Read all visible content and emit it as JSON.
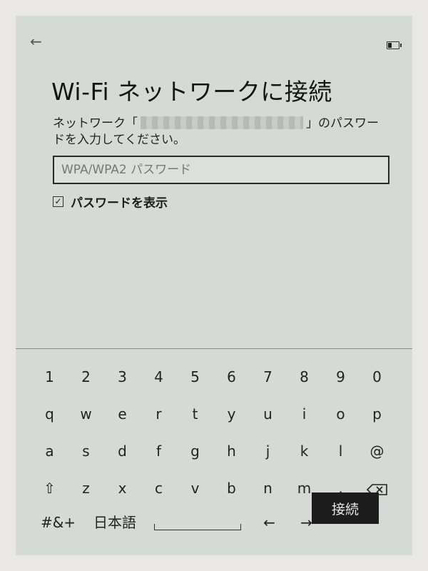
{
  "status": {
    "battery_level": 0.4
  },
  "header": {
    "back_icon": "arrow-left-icon"
  },
  "title": "Wi-Fi ネットワークに接続",
  "description": {
    "prefix": "ネットワーク「",
    "suffix": "」のパスワードを入力してください。"
  },
  "password": {
    "placeholder": "WPA/WPA2 パスワード",
    "value": ""
  },
  "show_password": {
    "label": "パスワードを表示",
    "checked": true
  },
  "keyboard": {
    "row1": [
      "1",
      "2",
      "3",
      "4",
      "5",
      "6",
      "7",
      "8",
      "9",
      "0"
    ],
    "row2": [
      "q",
      "w",
      "e",
      "r",
      "t",
      "y",
      "u",
      "i",
      "o",
      "p"
    ],
    "row3": [
      "a",
      "s",
      "d",
      "f",
      "g",
      "h",
      "j",
      "k",
      "l",
      "@"
    ],
    "row4": [
      "z",
      "x",
      "c",
      "v",
      "b",
      "n",
      "m",
      "."
    ],
    "symbols_label": "#&+",
    "language_label": "日本語",
    "left_arrow": "←",
    "right_arrow": "→",
    "shift_glyph": "⇧"
  },
  "connect_button": {
    "label": "接続"
  }
}
